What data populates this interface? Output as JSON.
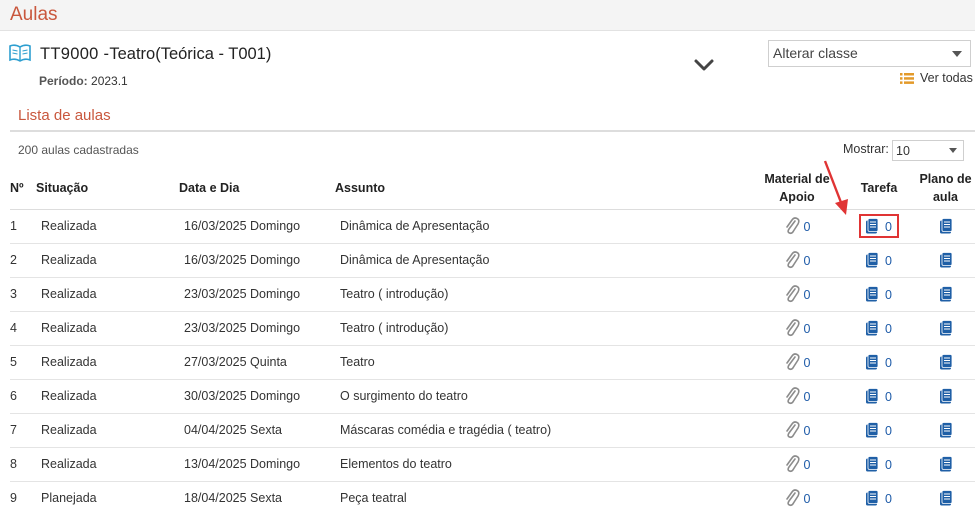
{
  "page": {
    "title": "Aulas"
  },
  "course": {
    "code": "TT9000 -",
    "name": "Teatro",
    "detail": "(Teórica - T001)",
    "period_label": "Período:",
    "period_value": "2023.1"
  },
  "class_select": {
    "value": "Alterar classe"
  },
  "view_all_label": "Ver todas",
  "section": {
    "title": "Lista de aulas"
  },
  "list": {
    "count_text": "200 aulas cadastradas",
    "show_label": "Mostrar:",
    "show_value": "10",
    "headers": {
      "num": "Nº",
      "situacao": "Situação",
      "data": "Data e Dia",
      "assunto": "Assunto",
      "material_1": "Material de",
      "material_2": "Apoio",
      "tarefa": "Tarefa",
      "plano_1": "Plano de",
      "plano_2": "aula"
    },
    "rows": [
      {
        "num": "1",
        "situacao": "Realizada",
        "data": "16/03/2025 Domingo",
        "assunto": "Dinâmica de Apresentação",
        "material": "0",
        "tarefa": "0"
      },
      {
        "num": "2",
        "situacao": "Realizada",
        "data": "16/03/2025 Domingo",
        "assunto": "Dinâmica de Apresentação",
        "material": "0",
        "tarefa": "0"
      },
      {
        "num": "3",
        "situacao": "Realizada",
        "data": "23/03/2025 Domingo",
        "assunto": "Teatro ( introdução)",
        "material": "0",
        "tarefa": "0"
      },
      {
        "num": "4",
        "situacao": "Realizada",
        "data": "23/03/2025 Domingo",
        "assunto": "Teatro ( introdução)",
        "material": "0",
        "tarefa": "0"
      },
      {
        "num": "5",
        "situacao": "Realizada",
        "data": "27/03/2025 Quinta",
        "assunto": "Teatro",
        "material": "0",
        "tarefa": "0"
      },
      {
        "num": "6",
        "situacao": "Realizada",
        "data": "30/03/2025 Domingo",
        "assunto": "O surgimento do teatro",
        "material": "0",
        "tarefa": "0"
      },
      {
        "num": "7",
        "situacao": "Realizada",
        "data": "04/04/2025 Sexta",
        "assunto": "Máscaras comédia e tragédia ( teatro)",
        "material": "0",
        "tarefa": "0"
      },
      {
        "num": "8",
        "situacao": "Realizada",
        "data": "13/04/2025 Domingo",
        "assunto": "Elementos do teatro",
        "material": "0",
        "tarefa": "0"
      },
      {
        "num": "9",
        "situacao": "Planejada",
        "data": "18/04/2025 Sexta",
        "assunto": "Peça teatral",
        "material": "0",
        "tarefa": "0"
      }
    ]
  },
  "colors": {
    "accent": "#c9573d",
    "link": "#1e5ba8",
    "highlight": "#e03434",
    "icon_blue": "#1f5fa6"
  },
  "icons": {
    "course": "book-icon",
    "expand": "chevron-down-icon",
    "view_all": "list-icon",
    "material": "paperclip-icon",
    "task": "document-icon",
    "plan": "document-icon"
  }
}
